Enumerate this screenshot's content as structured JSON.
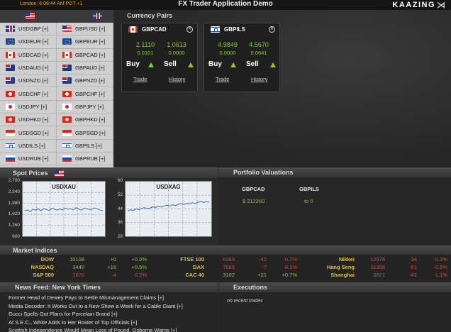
{
  "app": {
    "clock": "London:  6:08:44 AM PDT +1",
    "title": "FX Trader Application Demo",
    "brand": "KAAZING",
    "brand_mark": "⋊"
  },
  "currency_list": {
    "header_flags": [
      "flag-us",
      "flag-gb"
    ],
    "rows": [
      {
        "usd": "USDGBP [+]",
        "usd_flag": "flag-gb",
        "gbp": "GBPUSD [+]",
        "gbp_flag": "flag-us"
      },
      {
        "usd": "USDEUR [+]",
        "usd_flag": "flag-eu",
        "gbp": "GBPEUR [+]",
        "gbp_flag": "flag-eu"
      },
      {
        "usd": "USDCAD [+]",
        "usd_flag": "flag-ca",
        "gbp": "GBPCAD [+]",
        "gbp_flag": "flag-ca"
      },
      {
        "usd": "USDAUD [+]",
        "usd_flag": "flag-au",
        "gbp": "GBPAUD [+]",
        "gbp_flag": "flag-au"
      },
      {
        "usd": "USDNZD [+]",
        "usd_flag": "flag-nz",
        "gbp": "GBPNZD [+]",
        "gbp_flag": "flag-nz"
      },
      {
        "usd": "USDCHF [+]",
        "usd_flag": "flag-ch",
        "gbp": "GBPCHF [+]",
        "gbp_flag": "flag-ch"
      },
      {
        "usd": "USDJPY [+]",
        "usd_flag": "flag-jp",
        "gbp": "GBPJPY [+]",
        "gbp_flag": "flag-jp"
      },
      {
        "usd": "USDHKD [+]",
        "usd_flag": "flag-hk",
        "gbp": "GBPHKD [+]",
        "gbp_flag": "flag-hk"
      },
      {
        "usd": "USDSGD [+]",
        "usd_flag": "flag-sg",
        "gbp": "GBPSGD [+]",
        "gbp_flag": "flag-sg"
      },
      {
        "usd": "USDILS [+]",
        "usd_flag": "flag-il",
        "gbp": "GBPILS [+]",
        "gbp_flag": "flag-il"
      },
      {
        "usd": "USDRUB [+]",
        "usd_flag": "flag-ru",
        "gbp": "GBPRUB [+]",
        "gbp_flag": "flag-ru"
      }
    ]
  },
  "currency_pairs": {
    "title": "Currency Pairs",
    "cards": [
      {
        "name": "GBPCAD",
        "flag": "flag-ca",
        "buy_price": "2.1110",
        "sell_price": "1.0613",
        "buy_spread": "0.0101",
        "sell_spread": "0.0000",
        "buy": "Buy",
        "sell": "Sell",
        "trade": "Trade",
        "history": "History"
      },
      {
        "name": "GBPILS",
        "flag": "flag-il",
        "buy_price": "4.9849",
        "sell_price": "4.5670",
        "buy_spread": "0.0000",
        "sell_spread": "0.0641",
        "buy": "Buy",
        "sell": "Sell",
        "trade": "Trade",
        "history": "History"
      }
    ]
  },
  "spot_prices": {
    "title": "Spot Prices",
    "flag": "flag-us"
  },
  "chart_data": [
    {
      "type": "line",
      "title": "USDXAU",
      "ylim": [
        900,
        2700
      ],
      "yticks": [
        "2,700",
        "2,340",
        "1,980",
        "1,620",
        "1,260",
        "900"
      ],
      "grid": true,
      "values": [
        1740,
        1770,
        1710,
        1790,
        1760,
        1800,
        1740,
        1810,
        1780,
        1750,
        1820,
        1790,
        1760,
        1800,
        1770,
        1830,
        1790,
        1810,
        1770,
        1840,
        1800,
        1760,
        1820,
        1810,
        1780,
        1790,
        1830,
        1800,
        1760,
        1740
      ]
    },
    {
      "type": "line",
      "title": "USDXAG",
      "ylim": [
        28,
        60
      ],
      "yticks": [
        "60",
        "52",
        "44",
        "36",
        "28"
      ],
      "grid": true,
      "values": [
        42.8,
        43.5,
        43.1,
        44.0,
        43.6,
        44.3,
        44.8,
        44.1,
        44.6,
        45.2,
        44.9,
        45.5,
        45.1,
        45.8,
        46.2,
        45.7,
        46.4,
        46.0,
        46.7,
        47.1,
        46.6,
        47.3,
        47.0,
        47.6,
        47.2,
        47.9,
        48.3,
        47.8,
        48.2,
        48.0
      ]
    }
  ],
  "portfolio": {
    "title": "Portfolio Valuations",
    "columns": [
      {
        "name": "GBPCAD",
        "value": "$ 212260"
      },
      {
        "name": "GBPILS",
        "value": "to 0"
      }
    ]
  },
  "market_indices": {
    "title": "Market Indices",
    "rows": [
      [
        {
          "name": "DOW",
          "value": "10108",
          "change": "+0",
          "pct": "+0.0%",
          "dir": "up"
        },
        {
          "name": "FTSE 100",
          "value": "6369",
          "change": "-42",
          "pct": "-0.7%",
          "dir": "down"
        },
        {
          "name": "Nikkei",
          "value": "12576",
          "change": "-34",
          "pct": "-0.3%",
          "dir": "down"
        }
      ],
      [
        {
          "name": "NASDAQ",
          "value": "3440",
          "change": "+16",
          "pct": "+0.5%",
          "dir": "up"
        },
        {
          "name": "DAX",
          "value": "7689",
          "change": "-7",
          "pct": "-0.1%",
          "dir": "down"
        },
        {
          "name": "Hang Seng",
          "value": "11956",
          "change": "-61",
          "pct": "-0.5%",
          "dir": "down"
        }
      ],
      [
        {
          "name": "S&P 500",
          "value": "1670",
          "change": "-4",
          "pct": "-0.2%",
          "dir": "down"
        },
        {
          "name": "CAC 40",
          "value": "3102",
          "change": "+21",
          "pct": "+0.7%",
          "dir": "up"
        },
        {
          "name": "Shanghai",
          "value": "3821",
          "change": "-41",
          "pct": "-1.1%",
          "dir": "down"
        }
      ]
    ]
  },
  "news": {
    "title": "News Feed:   New York Times",
    "items": [
      "Former Head of Dewey Pays to Settle Mismanagement Claims  [+]",
      "Media Decoder: It Works Out to a New Show a Week for a Cable Giant  [+]",
      "Gucci Spells Out Plans for Porcelain Brand  [+]",
      "At S.E.C., White Adds to Her Roster of Top Officials  [+]",
      "Scottish Independence Would Mean Loss of Pound, Osborne Warns  [+]"
    ]
  },
  "executions": {
    "title": "Executions",
    "empty": "no recent trades"
  },
  "colors": {
    "up": "#8dc63f",
    "down": "#d9473d",
    "index_name": "#d8c04a",
    "clock": "#e8a323"
  }
}
